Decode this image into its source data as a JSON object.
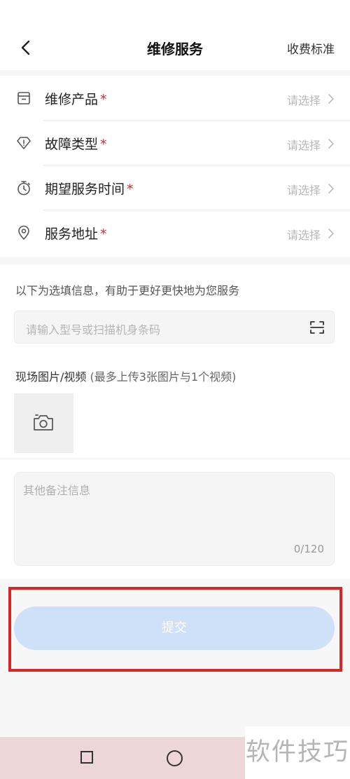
{
  "header": {
    "title": "维修服务",
    "right_link": "收费标准"
  },
  "form": {
    "required_mark": "*",
    "rows": [
      {
        "label": "维修产品",
        "value": "请选择",
        "icon": "product-box-icon"
      },
      {
        "label": "故障类型",
        "value": "请选择",
        "icon": "diamond-alert-icon"
      },
      {
        "label": "期望服务时间",
        "value": "请选择",
        "icon": "stopwatch-icon"
      },
      {
        "label": "服务地址",
        "value": "请选择",
        "icon": "location-pin-icon"
      }
    ]
  },
  "optional": {
    "hint": "以下为选填信息，有助于更好更快地为您服务",
    "model_input_placeholder": "请输入型号或扫描机身条码",
    "media_label": "现场图片/视频",
    "media_sub": "(最多上传3张图片与1个视频)"
  },
  "notes": {
    "placeholder": "其他备注信息",
    "counter": "0/120"
  },
  "submit_label": "提交",
  "watermark": "软件技巧",
  "colors": {
    "required": "#d92b2b",
    "submit_bg": "#cfe0f9",
    "highlight": "#d92525"
  }
}
